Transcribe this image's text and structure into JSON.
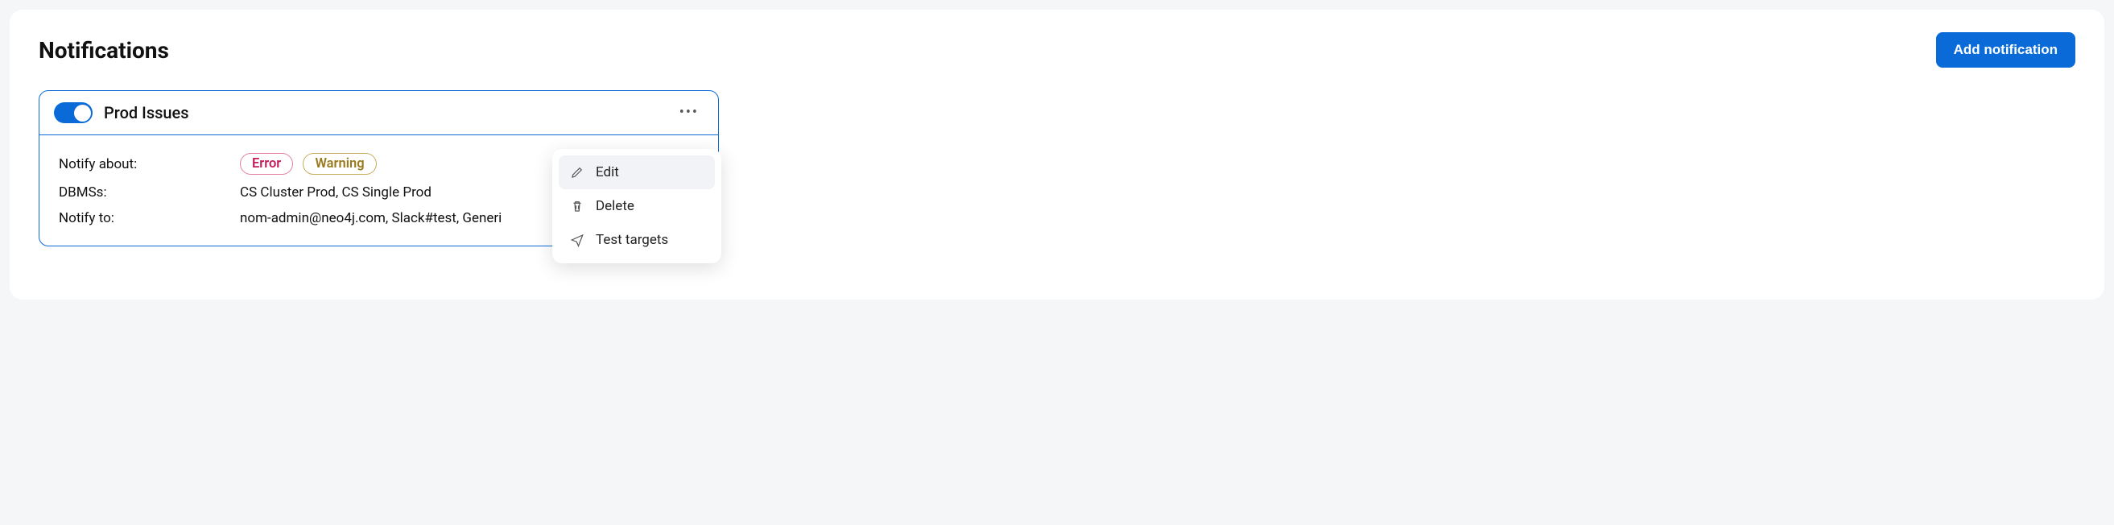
{
  "header": {
    "title": "Notifications",
    "add_button": "Add notification"
  },
  "card": {
    "title": "Prod Issues",
    "toggle_on": true,
    "labels": {
      "notify_about": "Notify about:",
      "dbms": "DBMSs:",
      "notify_to": "Notify to:"
    },
    "badges": {
      "error": "Error",
      "warning": "Warning"
    },
    "dbms_value": "CS Cluster Prod, CS Single Prod",
    "notify_to_value": "nom-admin@neo4j.com, Slack#test, Generi"
  },
  "menu": {
    "edit": "Edit",
    "delete": "Delete",
    "test": "Test targets"
  }
}
